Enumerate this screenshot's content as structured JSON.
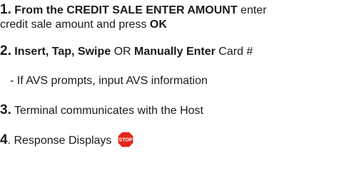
{
  "steps": [
    {
      "number": "1",
      "number_suffix": ".",
      "bold_text": " From the CREDIT SALE ENTER AMOUNT",
      "text": " enter",
      "line2_text": "credit sale amount and press ",
      "line2_bold": "OK"
    },
    {
      "number": "2.",
      "bold_text": " Insert, Tap, Swipe",
      "text_1": " OR ",
      "bold_text_2": "Manually Enter",
      "text_2": " Card #"
    },
    {
      "sub_note": "- If AVS prompts, input AVS information"
    },
    {
      "number": "3.",
      "text": " Terminal communicates with the Host"
    },
    {
      "number": "4",
      "text": ". Response Displays ",
      "icon": "stop-sign-icon",
      "icon_label": "STOP",
      "icon_color": "#e3261b"
    }
  ]
}
